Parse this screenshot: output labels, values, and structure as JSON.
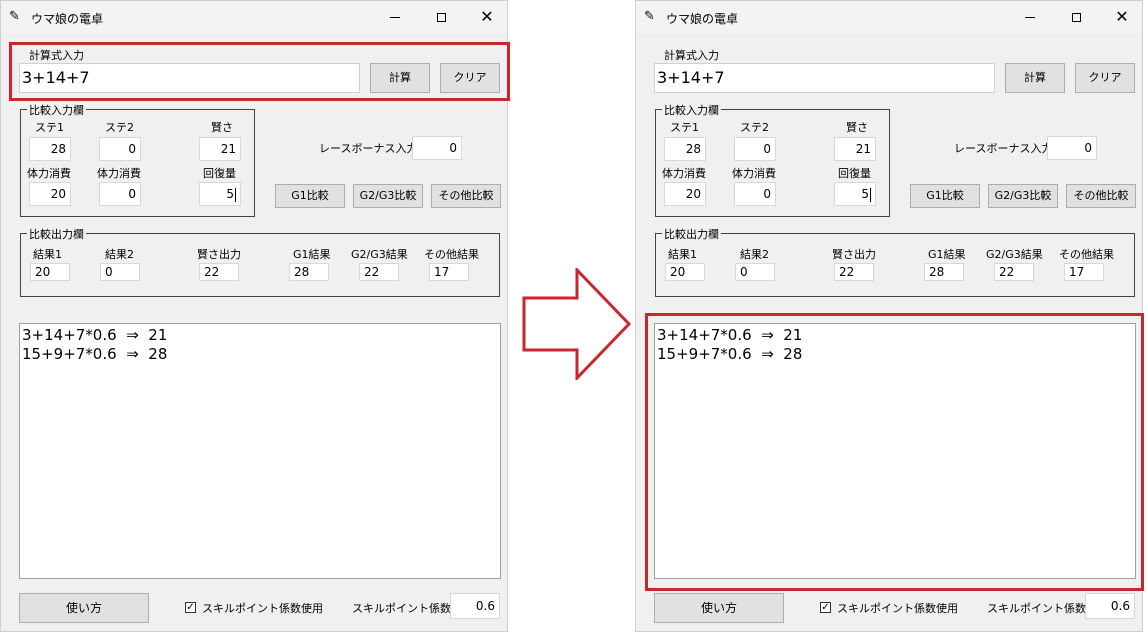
{
  "window": {
    "title": "ウマ娘の電卓",
    "icon": "feather-icon",
    "controls": {
      "minimize": "minimize-icon",
      "maximize": "maximize-icon",
      "close": "✕"
    }
  },
  "formula": {
    "label": "計算式入力",
    "value": "3+14+7",
    "calc_button": "計算",
    "clear_button": "クリア"
  },
  "compare_input": {
    "title": "比較入力欄",
    "stat1_label": "ステ1",
    "stat1_value": "28",
    "stat2_label": "ステ2",
    "stat2_value": "0",
    "wisdom_label": "賢さ",
    "wisdom_value": "21",
    "stamina_cost1_label": "体力消費",
    "stamina_cost1_value": "20",
    "stamina_cost2_label": "体力消費",
    "stamina_cost2_value": "0",
    "recovery_label": "回復量",
    "recovery_value": "5"
  },
  "race_bonus": {
    "label": "レースボーナス入力",
    "value": "0"
  },
  "compare_buttons": {
    "g1": "G1比較",
    "g2g3": "G2/G3比較",
    "other": "その他比較"
  },
  "compare_output": {
    "title": "比較出力欄",
    "headers": [
      "結果1",
      "結果2",
      "賢さ出力",
      "G1結果",
      "G2/G3結果",
      "その他結果"
    ],
    "values": [
      "20",
      "0",
      "22",
      "28",
      "22",
      "17"
    ]
  },
  "log": {
    "lines": [
      "3+14+7*0.6  ⇒  21",
      "15+9+7*0.6  ⇒  28"
    ]
  },
  "footer": {
    "usage_button": "使い方",
    "skill_checkbox_label": "スキルポイント係数使用",
    "skill_checked": true,
    "check_mark": "✓",
    "skill_coef_label": "スキルポイント係数",
    "skill_coef_value": "0.6"
  },
  "colors": {
    "highlight": "#c8282d",
    "window_bg": "#f0f0f0",
    "button_bg": "#e1e1e1"
  }
}
